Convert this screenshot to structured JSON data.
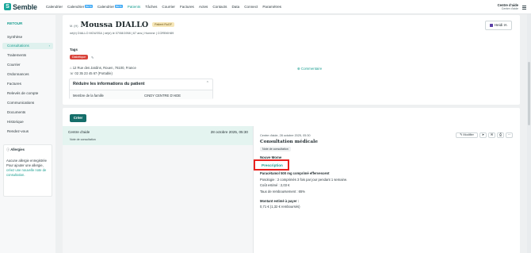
{
  "brand": {
    "name": "Semble",
    "accent": "#1a9e90"
  },
  "nav": {
    "items": [
      {
        "label": "Calendrier",
        "beta": ""
      },
      {
        "label": "Calendrier",
        "beta": "BETA"
      },
      {
        "label": "Calendrier",
        "beta": "BETA"
      },
      {
        "label": "Patients",
        "beta": ""
      },
      {
        "label": "Tâches",
        "beta": ""
      },
      {
        "label": "Courrier",
        "beta": ""
      },
      {
        "label": "Factures",
        "beta": ""
      },
      {
        "label": "Actes",
        "beta": ""
      },
      {
        "label": "Contacts",
        "beta": ""
      },
      {
        "label": "Data",
        "beta": ""
      },
      {
        "label": "Connect",
        "beta": ""
      },
      {
        "label": "Paramètres",
        "beta": ""
      }
    ],
    "active_index": 3,
    "centre_title": "Centre d'aide",
    "centre_sub": "Centre d'aide"
  },
  "sidebar": {
    "back": "RETOUR",
    "items": [
      "Synthèse",
      "Consultations",
      "Traitements",
      "Courrier",
      "Ordonnances",
      "Factures",
      "Relevés de compte",
      "Communications",
      "Documents",
      "Historique",
      "Rendez-vous"
    ],
    "active_index": 1,
    "allergy": {
      "title": "Allergies",
      "none": "Aucune allergie enregistrée",
      "hint": "Pour ajouter une allergie,",
      "link": "créez une nouvelle note de consultation."
    }
  },
  "patient": {
    "civility": "M. (H)",
    "name": "Moussa DIALLO",
    "badge": "Patient RuGF",
    "meta": "né(e) DIALLO MOUSSA  |  né(e) le 07/08/1958  |  67 ans  |  Homme  |  CORBKH89",
    "tags_label": "Tags",
    "tag": "Diabétique",
    "address": "12 Rue des Jardins, Rouen, 76100, France",
    "phone": "02 35 23 45 67 (Portable)",
    "comment": "Commentaire",
    "reduce_title": "Réduire les informations du patient",
    "family_label": "Membre de la famille",
    "family_value": "CINDY CENTRE D'AIDE"
  },
  "heidi": {
    "label": "Heidi IA"
  },
  "order_button": "Créer",
  "consultation_list": [
    {
      "place": "Centre d'aide",
      "date": "28 octobre 2025, 05:30",
      "note": "Note de consultation"
    }
  ],
  "detail": {
    "header": "Centre d'aide, 28 octobre 2025, 05:30",
    "title": "Consultation médicale",
    "tag": "Note de consultation",
    "modify": "Modifier",
    "section_hidden": "Nouve Mome",
    "prescription": "Prescription",
    "drug": "Paracétamol 500 mg comprimé effervescent",
    "lines": [
      "Posologie : 2 comprimés 3 fois par jour pendant 1 semaine.",
      "Coût estimé : 2,03 €",
      "Taux de remboursement : 65%"
    ],
    "total_label": "Montant estimé à payer :",
    "total": "0,71 € (1,32 € remboursés)"
  }
}
